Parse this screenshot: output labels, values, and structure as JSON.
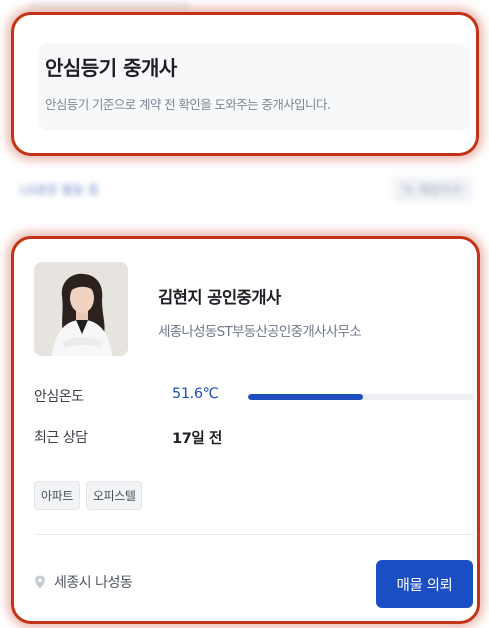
{
  "background": {
    "faded_row_left": "LG방문 활동 중",
    "faded_row_right": "% 재방지수"
  },
  "info_card": {
    "title": "안심등기 중개사",
    "description": "안심등기 기준으로 계약 전 확인을 도와주는 중개사입니다."
  },
  "agent": {
    "name": "김현지 공인중개사",
    "office": "세종나성동ST부동산공인중개사사무소",
    "temperature_label": "안심온도",
    "temperature_value": "51.6℃",
    "temperature_fraction": 0.51,
    "consult_label": "최근 상담",
    "consult_value": "17일 전",
    "tags": [
      "아파트",
      "오피스텔"
    ],
    "location": "세종시 나성동",
    "request_button": "매물 의뢰"
  },
  "colors": {
    "accent_blue": "#1a4ec2",
    "highlight_red": "#c23317"
  },
  "icons": {
    "location": "map-pin-icon"
  }
}
